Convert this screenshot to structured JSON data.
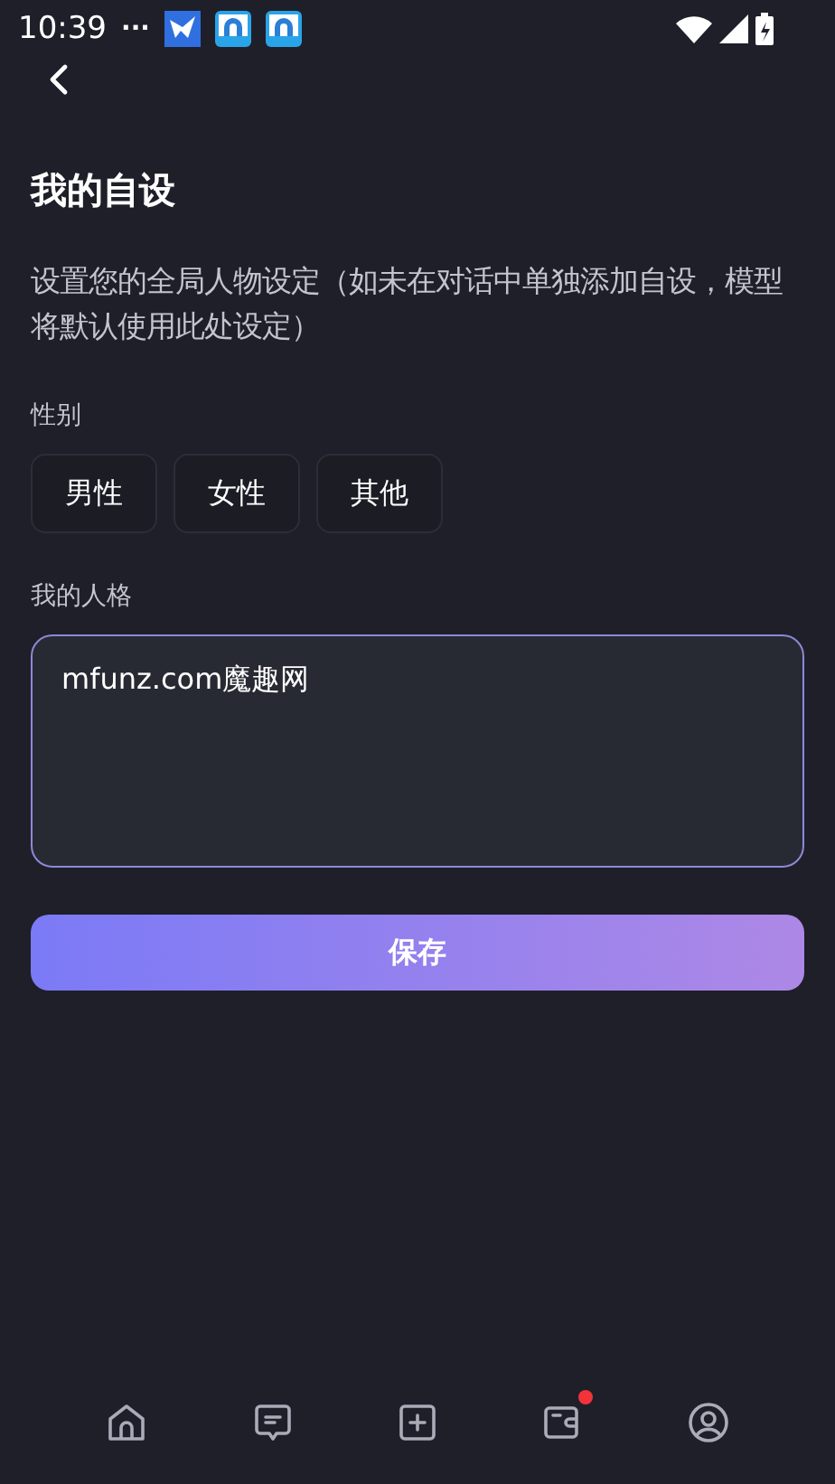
{
  "status_bar": {
    "time": "10:39",
    "dots": "···"
  },
  "title": "我的自设",
  "description": "设置您的全局人物设定（如未在对话中单独添加自设，模型将默认使用此处设定）",
  "gender": {
    "label": "性别",
    "options": [
      {
        "label": "男性",
        "selected": false
      },
      {
        "label": "女性",
        "selected": false
      },
      {
        "label": "其他",
        "selected": false
      }
    ]
  },
  "personality": {
    "label": "我的人格",
    "value": "mfunz.com魔趣网"
  },
  "save_button": "保存",
  "nav": [
    {
      "kind": "home",
      "badge": false
    },
    {
      "kind": "chat",
      "badge": false
    },
    {
      "kind": "add",
      "badge": false
    },
    {
      "kind": "wallet",
      "badge": true
    },
    {
      "kind": "profile",
      "badge": false
    }
  ]
}
